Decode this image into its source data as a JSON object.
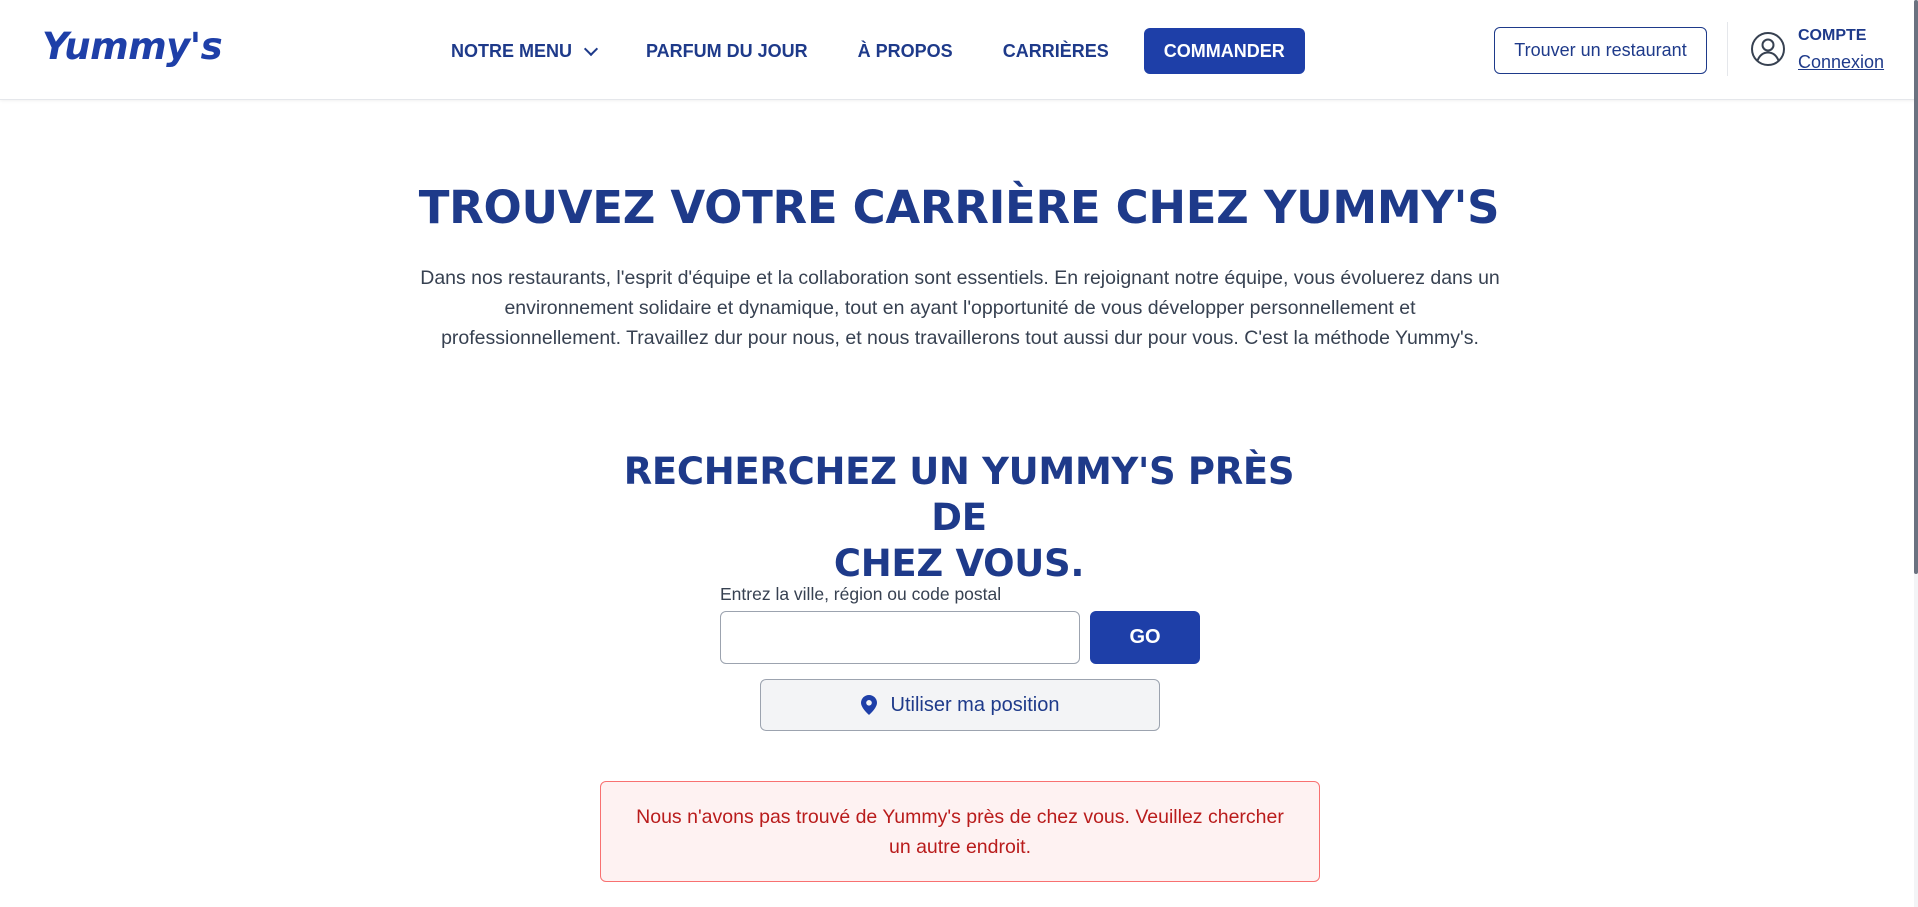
{
  "header": {
    "logo": "Yummy's",
    "nav": {
      "menu": "NOTRE MENU",
      "flavor_of_day": "PARFUM DU JOUR",
      "about": "À PROPOS",
      "careers": "CARRIÈRES",
      "order": "COMMANDER"
    },
    "find_restaurant": "Trouver un restaurant",
    "account": {
      "title": "COMPTE",
      "login": "Connexion"
    }
  },
  "hero": {
    "title": "TROUVEZ VOTRE CARRIÈRE CHEZ YUMMY'S",
    "intro_lines": [
      "Dans nos restaurants, l'esprit d'équipe et la collaboration sont essentiels. En rejoignant notre équipe, vous évoluerez dans un",
      "environnement solidaire et dynamique, tout en ayant l'opportunité de vous développer personnellement et",
      "professionnellement. Travaillez dur pour nous, et nous travaillerons tout aussi dur pour vous. C'est la méthode Yummy's."
    ]
  },
  "search": {
    "heading_lines": [
      "RECHERCHEZ UN YUMMY'S PRÈS DE",
      "CHEZ VOUS."
    ],
    "input_label": "Entrez la ville, région ou code postal",
    "input_value": "",
    "go_label": "GO",
    "use_location_label": "Utiliser ma position"
  },
  "alert": {
    "message_lines": [
      "Nous n'avons pas trouvé de Yummy's près de chez vous. Veuillez chercher",
      "un autre endroit."
    ]
  },
  "colors": {
    "brand": "#1e3fa8",
    "text_heading": "#1e3a8a",
    "alert_text": "#b91c1c",
    "alert_bg": "#fef2f2",
    "alert_border": "#f87171"
  },
  "icons": {
    "nav_menu": "chevron-down-icon",
    "account": "user-circle-icon",
    "location": "map-pin-icon"
  }
}
